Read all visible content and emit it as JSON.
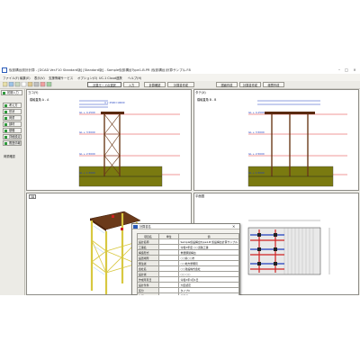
{
  "window": {
    "title": "仮設構台設計計算 - [DCAD Ver.F10 Standard版] [Standard版] - Sample仮設構台Type1-B.PR (仮設構台)計算サンプル.F8",
    "controls": [
      "–",
      "□",
      "×"
    ]
  },
  "menu": [
    "ファイル(F)",
    "編集(E)",
    "表示(V)",
    "支援情報サービス",
    "オプション(O)",
    "UC-1 Cloud連携",
    "ヘルプ(H)"
  ],
  "toolbar": {
    "dropdown": "計算モードの選択",
    "buttons": [
      "入力",
      "計算確認",
      "計算書作成",
      "図面作成",
      "計算書作成",
      "帳票作成"
    ]
  },
  "leftpanel": {
    "top_button": "初期入力",
    "items": [
      "考え方",
      "形状",
      "荷重",
      "部材",
      "基礎",
      "詳細設定",
      "照査情報"
    ],
    "calc_check": "荷重確認"
  },
  "panes": {
    "tl_title": "ヨコ(Y)",
    "tl_sub": "橋軸直角 A - A",
    "tr_title": "タテ(X)",
    "tr_sub": "橋軸直角 B - B",
    "bl_title": "3D",
    "br_title": "平面図",
    "elev_labels": [
      "GL + 4.1500",
      "GL + 3.5000",
      "GL + 2.5000",
      "GL + 1.5000",
      "GL + 0.5000",
      "GL ± 0.0000"
    ],
    "top_dims": [
      "4 × 2500=10000",
      "4500",
      "4600"
    ]
  },
  "dialog": {
    "title": "計算書名",
    "headers": [
      "項目名",
      "単位",
      "値"
    ],
    "rows": [
      {
        "k": "設計名称",
        "u": "",
        "v": "Sample仮設構台Type1-B 仮設構台計算サンプル"
      },
      {
        "k": "工事名",
        "u": "",
        "v": "令和X年度 ○○道路工事"
      },
      {
        "k": "構造形式",
        "u": "",
        "v": "重量鋼製構台"
      },
      {
        "k": "設置場所",
        "u": "",
        "v": "○○県○○市"
      },
      {
        "k": "発注者",
        "u": "",
        "v": "○○地方整備局"
      },
      {
        "k": "会社名",
        "u": "",
        "v": "○○建設株式会社"
      },
      {
        "k": "設計者",
        "u": "",
        "v": "○○ ○○"
      },
      {
        "k": "作成年月日",
        "u": "",
        "v": "令和X年1月1日"
      },
      {
        "k": "設計条件",
        "u": "",
        "v": "大臣認定"
      },
      {
        "k": "区分",
        "u": "",
        "v": "タイプC"
      },
      {
        "k": "位置",
        "u": "",
        "v": "工事用"
      },
      {
        "k": "準拠基準",
        "u": "",
        "v": "共通仕様"
      }
    ]
  },
  "colors": {
    "accent_green": "#2f9a3c",
    "frame_brown": "#6b3a1a",
    "ground_olive": "#7a7a10",
    "dim_red": "#d02020",
    "dim_blue": "#1f3fbf"
  }
}
